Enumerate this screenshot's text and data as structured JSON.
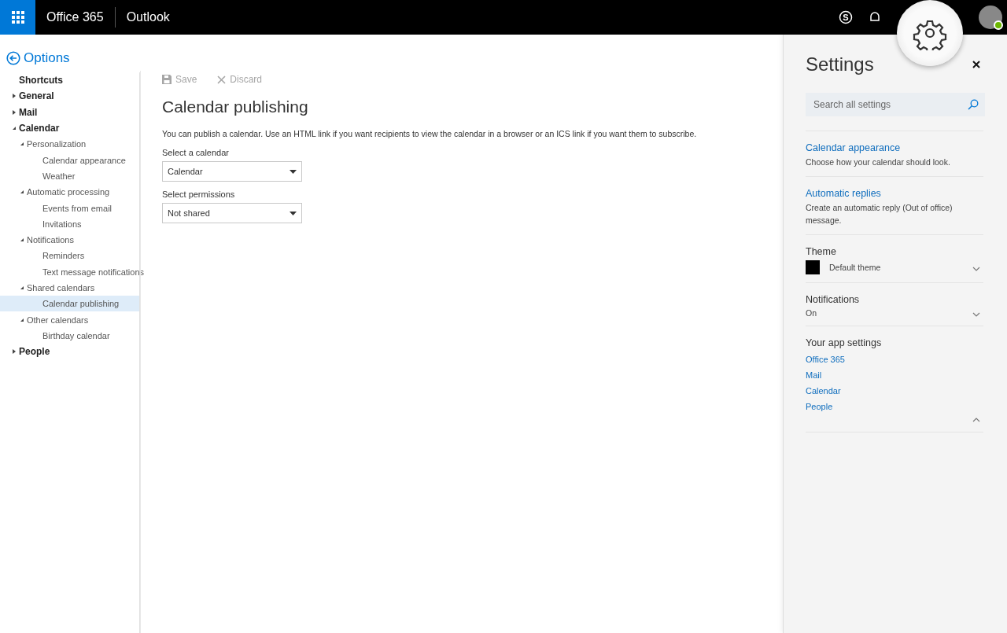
{
  "topbar": {
    "brand": "Office 365",
    "app": "Outlook",
    "presence_online": true,
    "skype_glyph": "S"
  },
  "back_title": "Options",
  "nav": [
    {
      "label": "Shortcuts",
      "kind": "link",
      "selected": false
    },
    {
      "label": "General",
      "kind": "group",
      "expanded": false,
      "selected": false
    },
    {
      "label": "Mail",
      "kind": "group",
      "expanded": false,
      "selected": false
    },
    {
      "label": "Calendar",
      "kind": "group",
      "expanded": true,
      "selected": false,
      "children": [
        {
          "label": "Personalization",
          "kind": "group",
          "expanded": true,
          "selected": false,
          "children": [
            {
              "label": "Calendar appearance",
              "kind": "link",
              "selected": false
            },
            {
              "label": "Weather",
              "kind": "link",
              "selected": false
            }
          ]
        },
        {
          "label": "Automatic processing",
          "kind": "group",
          "expanded": true,
          "selected": false,
          "children": [
            {
              "label": "Events from email",
              "kind": "link",
              "selected": false
            },
            {
              "label": "Invitations",
              "kind": "link",
              "selected": false
            }
          ]
        },
        {
          "label": "Notifications",
          "kind": "group",
          "expanded": true,
          "selected": false,
          "children": [
            {
              "label": "Reminders",
              "kind": "link",
              "selected": false
            },
            {
              "label": "Text message notifications",
              "kind": "link",
              "selected": false
            }
          ]
        },
        {
          "label": "Shared calendars",
          "kind": "group",
          "expanded": true,
          "selected": false,
          "children": [
            {
              "label": "Calendar publishing",
              "kind": "link",
              "selected": true
            }
          ]
        },
        {
          "label": "Other calendars",
          "kind": "group",
          "expanded": true,
          "selected": false,
          "children": [
            {
              "label": "Birthday calendar",
              "kind": "link",
              "selected": false
            }
          ]
        }
      ]
    },
    {
      "label": "People",
      "kind": "group",
      "expanded": false,
      "selected": false
    }
  ],
  "toolbar": [
    {
      "label": "Save",
      "kind": "save",
      "disabled": true
    },
    {
      "label": "Discard",
      "kind": "discard",
      "disabled": true
    }
  ],
  "page_title": "Calendar publishing",
  "description": "You can publish a calendar. Use an HTML link if you want recipients to view the calendar in a browser or an ICS link if you want them to subscribe.",
  "fields": [
    {
      "label": "Select a calendar",
      "value": "Calendar"
    },
    {
      "label": "Select permissions",
      "value": "Not shared"
    }
  ],
  "settings": {
    "title": "Settings",
    "search": {
      "placeholder": "Search all settings"
    },
    "links": [
      {
        "title": "Calendar appearance",
        "description": "Choose how your calendar should look."
      },
      {
        "title": "Automatic replies",
        "description": "Create an automatic reply (Out of office) message."
      }
    ],
    "theme": {
      "label": "Theme",
      "value": "Default theme",
      "expanded": false
    },
    "notifications": {
      "label": "Notifications",
      "value": "On",
      "expanded": false
    },
    "app_settings": {
      "label": "Your app settings",
      "expanded": true,
      "links": [
        "Office 365",
        "Mail",
        "Calendar",
        "People"
      ]
    }
  }
}
